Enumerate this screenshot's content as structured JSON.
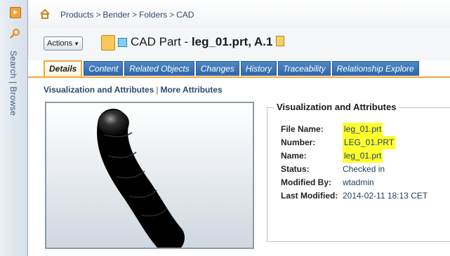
{
  "leftbar": {
    "search_label": "Search",
    "divider": "|",
    "browse_label": "Browse"
  },
  "breadcrumb": {
    "items": [
      "Products",
      "Bender",
      "Folders",
      "CAD"
    ],
    "separator": ">"
  },
  "header": {
    "actions_label": "Actions",
    "title_prefix": "CAD Part - ",
    "title_name": "leg_01.prt, A.1"
  },
  "tabs": [
    {
      "label": "Details"
    },
    {
      "label": "Content"
    },
    {
      "label": "Related Objects"
    },
    {
      "label": "Changes"
    },
    {
      "label": "History"
    },
    {
      "label": "Traceability"
    },
    {
      "label": "Relationship Explore"
    }
  ],
  "sublinks": {
    "visualization": "Visualization and Attributes",
    "divider": "|",
    "more": "More Attributes"
  },
  "attributes": {
    "title": "Visualization and Attributes",
    "rows": [
      {
        "label": "File Name:",
        "value": "leg_01.prt"
      },
      {
        "label": "Number:",
        "value": "LEG_01.PRT"
      },
      {
        "label": "Name:",
        "value": "leg_01.prt"
      },
      {
        "label": "Status:",
        "value": "Checked in"
      },
      {
        "label": "Modified By:",
        "value": "wtadmin"
      },
      {
        "label": "Last Modified:",
        "value": "2014-02-11 18:13 CET"
      }
    ]
  },
  "colors": {
    "accent_orange": "#f3a63a",
    "tab_blue": "#2f67a6",
    "highlight": "#ffff2e"
  },
  "icons": [
    "expand-icon",
    "search-icon",
    "home-icon",
    "cad-part-icon",
    "copy-icon"
  ]
}
